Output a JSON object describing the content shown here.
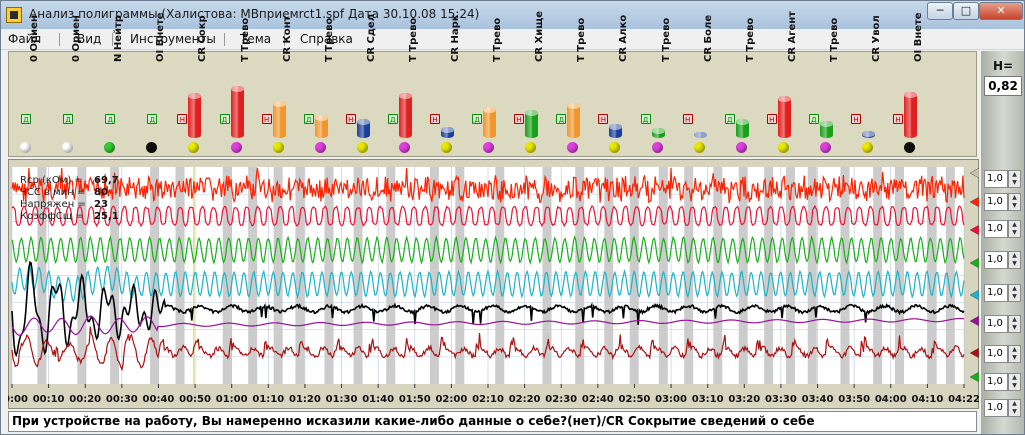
{
  "window": {
    "title": "Анализ полиграммы (Халистова: MBприемrct1.spf  Дата 30.10.08  15:24)",
    "minimize_glyph": "─",
    "maximize_glyph": "□",
    "close_glyph": "✕"
  },
  "menu": [
    "Файл",
    "Вид",
    "Инструменты",
    "Тема",
    "Справка"
  ],
  "topics": [
    {
      "code": "0 Ориен",
      "badge": "Д",
      "badge_type": "d",
      "bar_color": "",
      "bar_level": 0,
      "dot_color": "#ffffff"
    },
    {
      "code": "0 Ориен",
      "badge": "Д",
      "badge_type": "d",
      "bar_color": "",
      "bar_level": 0,
      "dot_color": "#ffffff"
    },
    {
      "code": "N Нейтр",
      "badge": "Д",
      "badge_type": "d",
      "bar_color": "",
      "bar_level": 0,
      "dot_color": "#33cc33"
    },
    {
      "code": "OI Внете",
      "badge": "Д",
      "badge_type": "d",
      "bar_color": "",
      "bar_level": 0,
      "dot_color": "#111111"
    },
    {
      "code": "CR Сокр",
      "badge": "Н",
      "badge_type": "n",
      "bar_color": "#e02020",
      "bar_level": 0.86,
      "dot_color": "#e8e800"
    },
    {
      "code": "T Трево",
      "badge": "Д",
      "badge_type": "d",
      "bar_color": "#e02020",
      "bar_level": 1.0,
      "dot_color": "#e040e0"
    },
    {
      "code": "CR Конт",
      "badge": "Н",
      "badge_type": "n",
      "bar_color": "#f0962a",
      "bar_level": 0.71,
      "dot_color": "#e8e800"
    },
    {
      "code": "T Трево",
      "badge": "Д",
      "badge_type": "d",
      "bar_color": "#f0962a",
      "bar_level": 0.45,
      "dot_color": "#e040e0"
    },
    {
      "code": "CR Сдел",
      "badge": "Н",
      "badge_type": "n",
      "bar_color": "#1a3e9a",
      "bar_level": 0.36,
      "dot_color": "#e8e800"
    },
    {
      "code": "T Трево",
      "badge": "Д",
      "badge_type": "d",
      "bar_color": "#e02020",
      "bar_level": 0.86,
      "dot_color": "#e040e0"
    },
    {
      "code": "CR Нарк",
      "badge": "Н",
      "badge_type": "n",
      "bar_color": "#1a3e9a",
      "bar_level": 0.22,
      "dot_color": "#e8e800"
    },
    {
      "code": "T Трево",
      "badge": "Д",
      "badge_type": "d",
      "bar_color": "#f0962a",
      "bar_level": 0.59,
      "dot_color": "#e040e0"
    },
    {
      "code": "CR Хище",
      "badge": "Н",
      "badge_type": "n",
      "bar_color": "#18a018",
      "bar_level": 0.54,
      "dot_color": "#e8e800"
    },
    {
      "code": "T Трево",
      "badge": "Д",
      "badge_type": "d",
      "bar_color": "#f0962a",
      "bar_level": 0.67,
      "dot_color": "#e040e0"
    },
    {
      "code": "CR Алко",
      "badge": "Н",
      "badge_type": "n",
      "bar_color": "#1a3e9a",
      "bar_level": 0.26,
      "dot_color": "#e8e800"
    },
    {
      "code": "T Трево",
      "badge": "Д",
      "badge_type": "d",
      "bar_color": "#18a018",
      "bar_level": 0.19,
      "dot_color": "#e040e0"
    },
    {
      "code": "CR Боле",
      "badge": "Н",
      "badge_type": "n",
      "bar_color": "#1a3e9a",
      "bar_level": 0.11,
      "dot_color": "#e8e800"
    },
    {
      "code": "T Трево",
      "badge": "Д",
      "badge_type": "d",
      "bar_color": "#18a018",
      "bar_level": 0.37,
      "dot_color": "#e040e0"
    },
    {
      "code": "CR Агент",
      "badge": "Н",
      "badge_type": "n",
      "bar_color": "#e02020",
      "bar_level": 0.8,
      "dot_color": "#e8e800"
    },
    {
      "code": "T Трево",
      "badge": "Д",
      "badge_type": "d",
      "bar_color": "#18a018",
      "bar_level": 0.32,
      "dot_color": "#e040e0"
    },
    {
      "code": "CR Увол",
      "badge": "Н",
      "badge_type": "n",
      "bar_color": "#1a3e9a",
      "bar_level": 0.13,
      "dot_color": "#e8e800"
    },
    {
      "code": "OI Внете",
      "badge": "Н",
      "badge_type": "n",
      "bar_color": "#e02020",
      "bar_level": 0.88,
      "dot_color": "#111111"
    }
  ],
  "sidebar": {
    "h_label": "H=",
    "h_value": "0,82",
    "gains": [
      "1,0",
      "1,0",
      "1,0",
      "1,0",
      "1,0",
      "1,0",
      "1,0",
      "1,0",
      "1,0"
    ],
    "spin_up": "▲",
    "spin_down": "▼"
  },
  "readouts": [
    {
      "label": "Rcp (кОм) =",
      "value": "69,7"
    },
    {
      "label": "ЧСС в мин =",
      "value": "80"
    },
    {
      "label": "Напряжен =",
      "value": "23"
    },
    {
      "label": "КоэффСщ =",
      "value": "25,1"
    }
  ],
  "chart_data": {
    "type": "line",
    "x_ticks": [
      "00:00",
      "00:10",
      "00:20",
      "00:30",
      "00:40",
      "00:50",
      "01:00",
      "01:10",
      "01:20",
      "01:30",
      "01:40",
      "01:50",
      "02:00",
      "02:10",
      "02:20",
      "02:30",
      "02:40",
      "02:50",
      "03:00",
      "03:10",
      "03:20",
      "03:30",
      "03:40",
      "03:50",
      "04:00",
      "04:10",
      "04:22"
    ],
    "x_range_seconds": [
      0,
      262
    ],
    "cursor_seconds": 50,
    "markers_seconds": [
      7,
      18,
      27,
      38,
      45,
      58,
      65,
      72,
      78,
      86,
      94,
      103,
      115,
      122,
      133,
      146,
      155,
      163,
      170,
      178,
      185,
      193,
      200,
      207,
      213,
      219,
      228,
      237,
      243,
      252,
      257
    ],
    "channels": [
      {
        "name": "ЧСС",
        "color": "#ff2200",
        "kind": "noise"
      },
      {
        "name": "",
        "color": "#ee1133",
        "kind": "wave"
      },
      {
        "name": "",
        "color": "#17b017",
        "kind": "wave"
      },
      {
        "name": "",
        "color": "#19b4c8",
        "kind": "wave"
      },
      {
        "name": "Rcp",
        "color": "#000000",
        "kind": "drift"
      },
      {
        "name": "",
        "color": "#991199",
        "kind": "flat"
      },
      {
        "name": "",
        "color": "#aa1111",
        "kind": "bumps"
      }
    ],
    "channel_arrow_colors": [
      "#c8c2a8",
      "#ff2200",
      "#ee1133",
      "#17b017",
      "#19b4c8",
      "#991199",
      "#aa1111",
      "#17b017"
    ],
    "grid": true
  },
  "status": {
    "question": "При устройстве на работу, Вы намеренно исказили какие-либо данные о себе?(нет)/CR Сокрытие сведений о себе"
  }
}
